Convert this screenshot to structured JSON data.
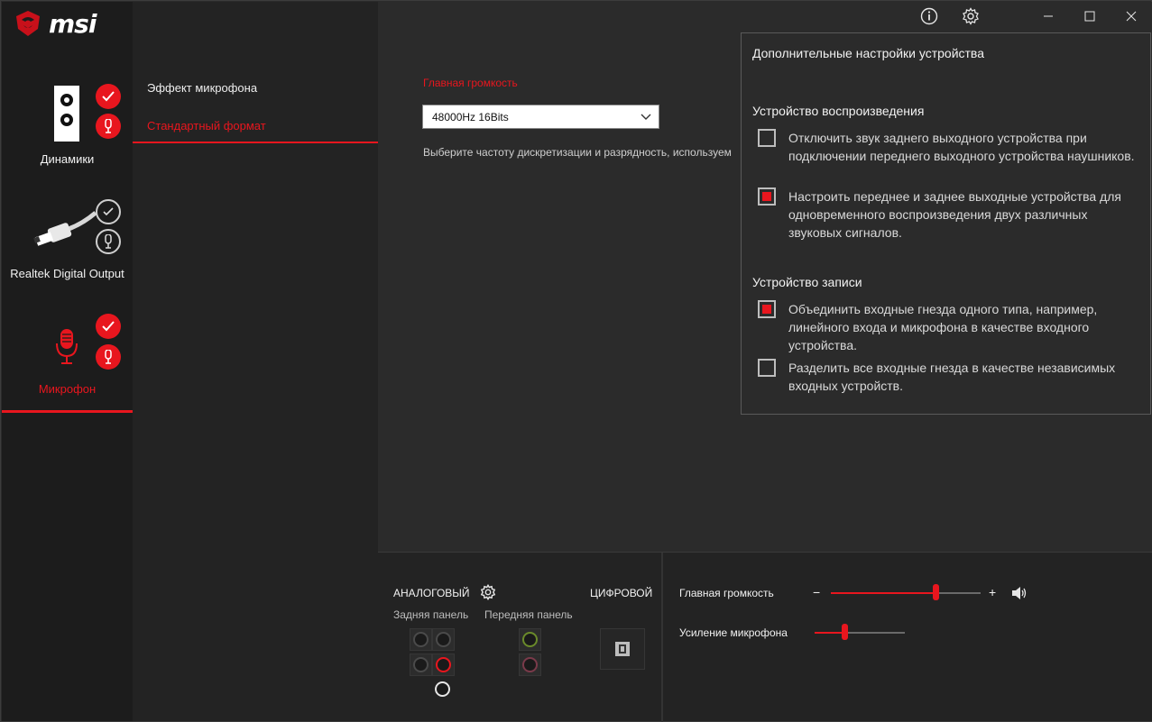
{
  "app": {
    "logo_text": "msi"
  },
  "devices": [
    {
      "label": "Динамики"
    },
    {
      "label": "Realtek Digital Output"
    },
    {
      "label": "Микрофон"
    }
  ],
  "submenu": [
    {
      "label": "Эффект микрофона"
    },
    {
      "label": "Стандартный формат"
    }
  ],
  "main": {
    "section_label": "Главная громкость",
    "format_select_value": "48000Hz 16Bits",
    "description": "Выберите частоту дискретизации и разрядность, используем"
  },
  "popup": {
    "title": "Дополнительные настройки устройства",
    "playback_section": "Устройство воспроизведения",
    "recording_section": "Устройство записи",
    "options": [
      {
        "text": "Отключить звук заднего выходного устройства при подключении переднего выходного устройства наушников.",
        "checked": false
      },
      {
        "text": "Настроить переднее и заднее выходные устройства для одновременного воспроизведения двух различных звуковых сигналов.",
        "checked": true
      },
      {
        "text": "Объединить входные гнезда одного типа, например, линейного входа и микрофона в качестве входного устройства.",
        "checked": true
      },
      {
        "text": "Разделить все входные гнезда в качестве независимых входных устройств.",
        "checked": false
      }
    ]
  },
  "bottom": {
    "analog_label": "АНАЛОГОВЫЙ",
    "digital_label": "ЦИФРОВОЙ",
    "rear_panel": "Задняя панель",
    "front_panel": "Передняя панель",
    "master_volume_label": "Главная громкость",
    "master_volume_minus": "−",
    "master_volume_plus": "+",
    "master_volume_level": 0.7,
    "mic_boost_label": "Усиление микрофона",
    "mic_boost_level": 0.33
  },
  "colors": {
    "accent": "#e8161e",
    "background": "#2b2b2b",
    "jack_green": "#6a8a2a",
    "jack_pink": "#7a3a4a"
  }
}
